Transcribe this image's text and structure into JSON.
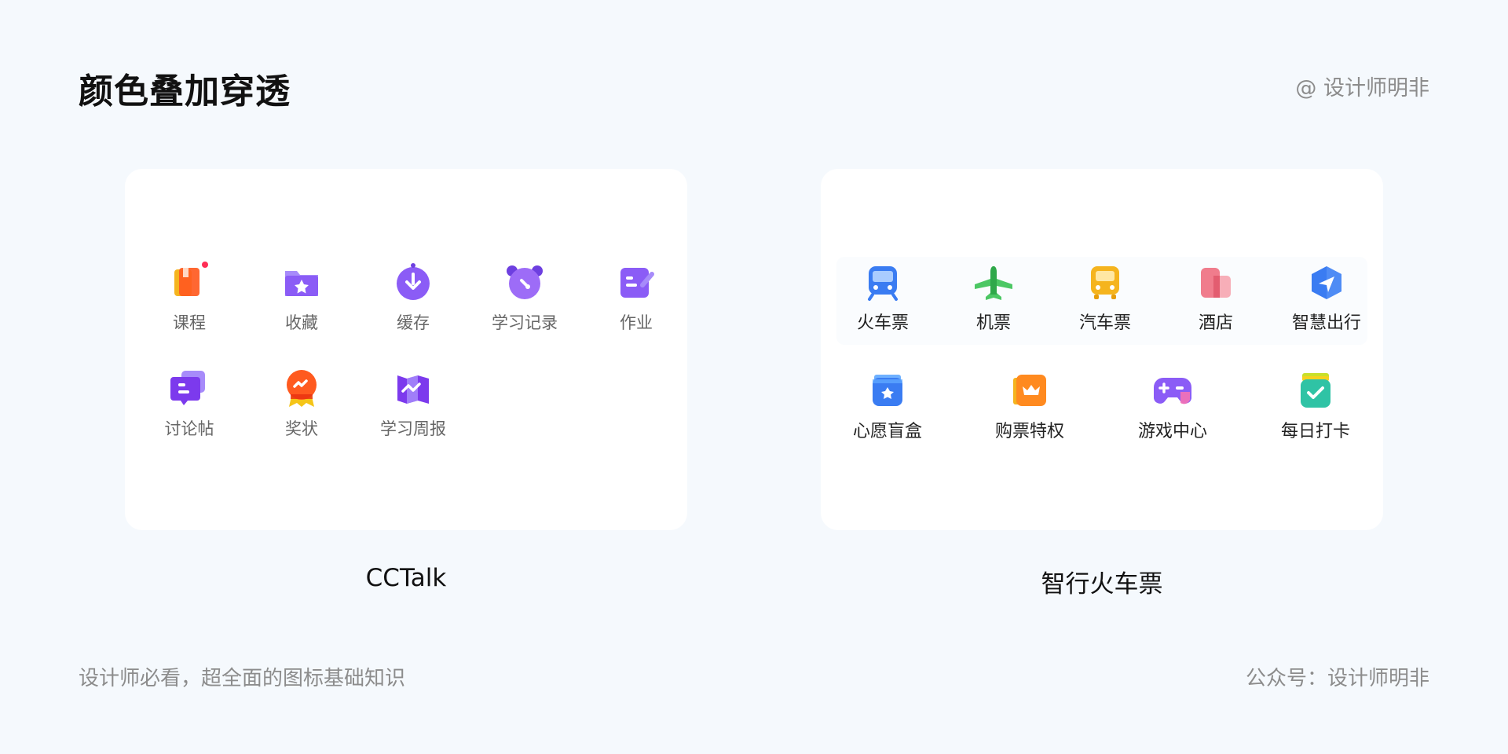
{
  "header": {
    "title": "颜色叠加穿透",
    "author": "@ 设计师明非"
  },
  "cards": {
    "cctalk": {
      "caption": "CCTalk",
      "items": [
        {
          "label": "课程",
          "icon": "course-book-icon"
        },
        {
          "label": "收藏",
          "icon": "favorites-folder-icon"
        },
        {
          "label": "缓存",
          "icon": "download-cache-icon"
        },
        {
          "label": "学习记录",
          "icon": "clock-record-icon"
        },
        {
          "label": "作业",
          "icon": "homework-edit-icon"
        },
        {
          "label": "讨论帖",
          "icon": "discussion-chat-icon"
        },
        {
          "label": "奖状",
          "icon": "award-medal-icon"
        },
        {
          "label": "学习周报",
          "icon": "weekly-report-icon"
        }
      ]
    },
    "zhixing": {
      "caption": "智行火车票",
      "items": [
        {
          "label": "火车票",
          "icon": "train-icon"
        },
        {
          "label": "机票",
          "icon": "plane-icon"
        },
        {
          "label": "汽车票",
          "icon": "bus-icon"
        },
        {
          "label": "酒店",
          "icon": "hotel-icon"
        },
        {
          "label": "智慧出行",
          "icon": "navigation-icon"
        },
        {
          "label": "心愿盲盒",
          "icon": "wish-box-icon"
        },
        {
          "label": "购票特权",
          "icon": "crown-privilege-icon"
        },
        {
          "label": "游戏中心",
          "icon": "gamepad-icon"
        },
        {
          "label": "每日打卡",
          "icon": "check-in-icon"
        }
      ]
    }
  },
  "footer": {
    "left": "设计师必看，超全面的图标基础知识",
    "right": "公众号：设计师明非"
  },
  "colors": {
    "background": "#f5f9fd",
    "purple": "#8b5cf6",
    "orange": "#ff5a1f",
    "blue": "#3a7cf2",
    "green": "#4cc764",
    "yellow": "#f5b41e",
    "pink": "#f07c8c",
    "teal": "#2fc3a5"
  }
}
